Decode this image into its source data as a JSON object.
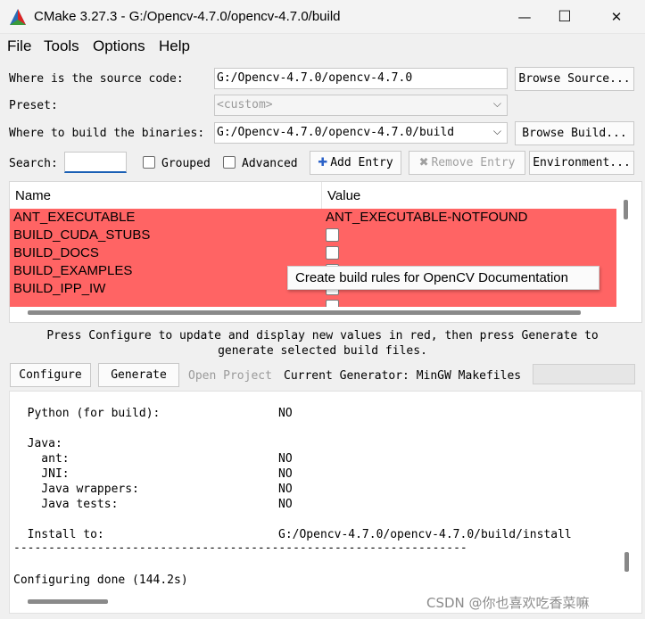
{
  "window": {
    "title": "CMake 3.27.3 - G:/Opencv-4.7.0/opencv-4.7.0/build",
    "minimize_glyph": "—",
    "maximize_glyph": "☐",
    "close_glyph": "✕"
  },
  "menu": [
    "File",
    "Tools",
    "Options",
    "Help"
  ],
  "form": {
    "source_label": "Where is the source code:",
    "source_value": "G:/Opencv-4.7.0/opencv-4.7.0",
    "browse_source": "Browse Source...",
    "preset_label": "Preset:",
    "preset_value": "<custom>",
    "binaries_label": "Where to build the binaries:",
    "binaries_value": "G:/Opencv-4.7.0/opencv-4.7.0/build",
    "browse_build": "Browse Build...",
    "search_label": "Search:",
    "search_value": "",
    "grouped_label": "Grouped",
    "advanced_label": "Advanced",
    "add_entry": "Add Entry",
    "remove_entry": "Remove Entry",
    "environment": "Environment..."
  },
  "table": {
    "headers": {
      "name": "Name",
      "value": "Value"
    },
    "rows": [
      {
        "name": "ANT_EXECUTABLE",
        "value": "ANT_EXECUTABLE-NOTFOUND",
        "checkbox": false
      },
      {
        "name": "BUILD_CUDA_STUBS",
        "value": "",
        "checkbox": true
      },
      {
        "name": "BUILD_DOCS",
        "value": "",
        "checkbox": true
      },
      {
        "name": "BUILD_EXAMPLES",
        "value": "",
        "checkbox": true
      },
      {
        "name": "BUILD_IPP_IW",
        "value": "",
        "checkbox": true
      }
    ],
    "row_color": "#ff6464"
  },
  "tooltip": "Create build rules for OpenCV Documentation",
  "hint": {
    "line1": "Press Configure to update and display new values in red, then press Generate to",
    "line2": "generate selected build files."
  },
  "actions": {
    "configure": "Configure",
    "generate": "Generate",
    "open_project": "Open Project",
    "generator_text": "Current Generator: MinGW Makefiles"
  },
  "output": {
    "lines": [
      {
        "text": "  Python (for build):",
        "value": "NO"
      },
      {
        "text": "",
        "value": ""
      },
      {
        "text": "  Java:",
        "value": ""
      },
      {
        "text": "    ant:",
        "value": "NO"
      },
      {
        "text": "    JNI:",
        "value": "NO"
      },
      {
        "text": "    Java wrappers:",
        "value": "NO"
      },
      {
        "text": "    Java tests:",
        "value": "NO"
      },
      {
        "text": "",
        "value": ""
      },
      {
        "text": "  Install to:",
        "value": "G:/Opencv-4.7.0/opencv-4.7.0/build/install"
      }
    ],
    "separator": "-----------------------------------------------------------------",
    "done": "Configuring done (144.2s)"
  },
  "watermark": "CSDN @你也喜欢吃香菜嘛"
}
